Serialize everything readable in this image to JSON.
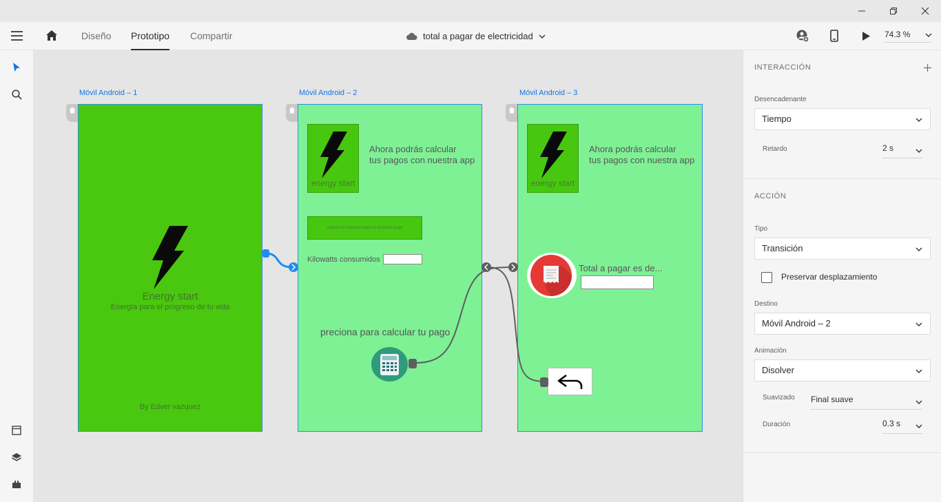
{
  "window": {
    "controls": [
      "minimize-icon",
      "restore-icon",
      "close-icon"
    ]
  },
  "toolbar": {
    "tabs": [
      {
        "label": "Diseño"
      },
      {
        "label": "Prototipo"
      },
      {
        "label": "Compartir"
      }
    ],
    "active_tab": "Prototipo",
    "document_title": "total a pagar de electricidad",
    "zoom": "74.3 %"
  },
  "rail": {
    "tools": [
      "select-tool-icon",
      "search-icon"
    ],
    "bottom": [
      "artboards-icon",
      "layers-icon",
      "plugins-icon"
    ]
  },
  "canvas": {
    "artboards": [
      {
        "label": "Móvil Android – 1",
        "title": "Energy start",
        "subtitle": "Energía para el progreso de tu vida",
        "footer": "By Edver vazquez"
      },
      {
        "label": "Móvil Android – 2",
        "logo_text": "energy start",
        "description_line1": "Ahora podrás calcular",
        "description_line2": "tus pagos con nuestra app",
        "button_text": "calcula tu consumo para tu próximo pago",
        "input_label": "Kilowatts consumidos",
        "cta_text": "preciona para calcular tu pago"
      },
      {
        "label": "Móvil Android – 3",
        "logo_text": "energy start",
        "description_line1": "Ahora podrás calcular",
        "description_line2": "tus pagos con nuestra app",
        "total_label": "Total a pagar es de..."
      }
    ],
    "colors": {
      "artboard1_bg": "#4ac70f",
      "artboard_light_bg": "#7ef195",
      "wire_blue": "#1f8cf0",
      "wire_gray": "#5e5e5e",
      "selection": "#2d8ceb"
    }
  },
  "panel": {
    "interaction": {
      "title": "INTERACCIÓN",
      "trigger_label": "Desencadenante",
      "trigger_value": "Tiempo",
      "delay_label": "Retardo",
      "delay_value": "2 s"
    },
    "action": {
      "title": "ACCIÓN",
      "type_label": "Tipo",
      "type_value": "Transición",
      "preserve_scroll_label": "Preservar desplazamiento",
      "preserve_scroll_checked": false,
      "destination_label": "Destino",
      "destination_value": "Móvil Android – 2",
      "animation_label": "Animación",
      "animation_value": "Disolver",
      "easing_label": "Suavizado",
      "easing_value": "Final suave",
      "duration_label": "Duración",
      "duration_value": "0.3 s"
    }
  }
}
